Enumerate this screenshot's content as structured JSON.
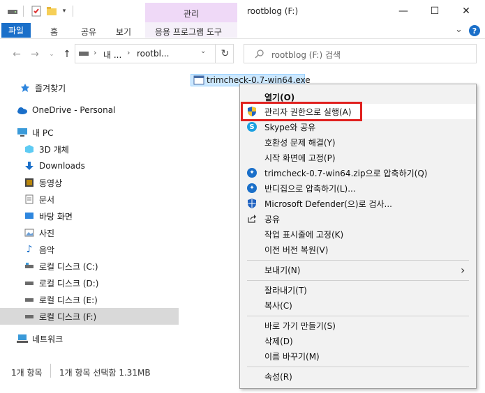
{
  "window": {
    "title": "rootblog (F:)",
    "manage_tab": "관리",
    "minimize": "—",
    "maximize": "☐",
    "close": "✕"
  },
  "ribbon": {
    "tabs": [
      "파일",
      "홈",
      "공유",
      "보기",
      "응용 프로그램 도구"
    ],
    "expand": "⌄",
    "help": "?"
  },
  "address": {
    "crumb1": "내 ...",
    "sep": "›",
    "crumb2": "rootbl...",
    "refresh": "↻"
  },
  "search": {
    "placeholder": "rootblog (F:) 검색"
  },
  "sidebar": {
    "items": [
      {
        "label": "즐겨찾기",
        "icon": "star-icon"
      },
      {
        "label": "OneDrive - Personal",
        "icon": "cloud-icon"
      },
      {
        "label": "내 PC",
        "icon": "pc-icon"
      },
      {
        "label": "3D 개체",
        "icon": "cube-icon"
      },
      {
        "label": "Downloads",
        "icon": "download-icon"
      },
      {
        "label": "동영상",
        "icon": "video-icon"
      },
      {
        "label": "문서",
        "icon": "document-icon"
      },
      {
        "label": "바탕 화면",
        "icon": "desktop-icon"
      },
      {
        "label": "사진",
        "icon": "picture-icon"
      },
      {
        "label": "음악",
        "icon": "music-icon"
      },
      {
        "label": "로컬 디스크 (C:)",
        "icon": "drive-icon"
      },
      {
        "label": "로컬 디스크 (D:)",
        "icon": "drive-icon"
      },
      {
        "label": "로컬 디스크 (E:)",
        "icon": "drive-icon"
      },
      {
        "label": "로컬 디스크 (F:)",
        "icon": "drive-icon"
      },
      {
        "label": "네트워크",
        "icon": "network-icon"
      }
    ]
  },
  "file": {
    "name": "trimcheck-0.7-win64.exe"
  },
  "status": {
    "count": "1개 항목",
    "selected": "1개 항목 선택함 1.31MB"
  },
  "context_menu": {
    "items": [
      {
        "label": "열기(O)",
        "icon": ""
      },
      {
        "label": "관리자 권한으로 실행(A)",
        "icon": "uac-shield-icon"
      },
      {
        "label": "Skype와 공유",
        "icon": "skype-icon"
      },
      {
        "label": "호환성 문제 해결(Y)",
        "icon": ""
      },
      {
        "label": "시작 화면에 고정(P)",
        "icon": ""
      },
      {
        "label": "trimcheck-0.7-win64.zip으로 압축하기(Q)",
        "icon": "bandizip-icon"
      },
      {
        "label": "반디집으로 압축하기(L)...",
        "icon": "bandizip-icon"
      },
      {
        "label": "Microsoft Defender(으)로 검사...",
        "icon": "defender-icon"
      },
      {
        "label": "공유",
        "icon": "share-icon"
      },
      {
        "label": "작업 표시줄에 고정(K)",
        "icon": ""
      },
      {
        "label": "이전 버전 복원(V)",
        "icon": ""
      },
      {
        "label": "보내기(N)",
        "icon": ""
      },
      {
        "label": "잘라내기(T)",
        "icon": ""
      },
      {
        "label": "복사(C)",
        "icon": ""
      },
      {
        "label": "바로 가기 만들기(S)",
        "icon": ""
      },
      {
        "label": "삭제(D)",
        "icon": ""
      },
      {
        "label": "이름 바꾸기(M)",
        "icon": ""
      },
      {
        "label": "속성(R)",
        "icon": ""
      }
    ],
    "submenu_arrow": "›"
  },
  "colors": {
    "accent": "#1a6fc9",
    "manage_tab": "#efd9f7",
    "highlight": "#e0211f"
  }
}
